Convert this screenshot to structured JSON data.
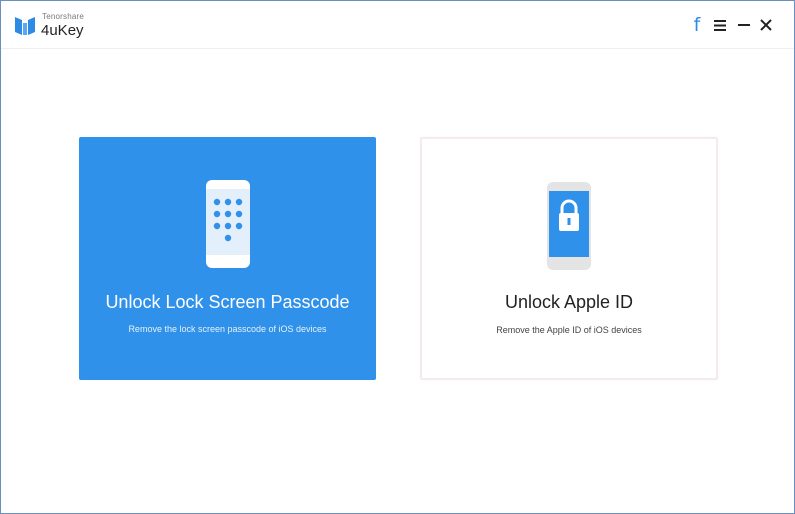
{
  "app": {
    "vendor": "Tenorshare",
    "name": "4uKey"
  },
  "toolbar": {
    "icons": [
      "facebook-icon",
      "menu-icon",
      "minimize-icon",
      "close-icon"
    ],
    "facebook_glyph": "f"
  },
  "options": [
    {
      "title": "Unlock Lock Screen Passcode",
      "description": "Remove the lock screen passcode of iOS devices",
      "icon": "phone-keypad-icon",
      "selected": true
    },
    {
      "title": "Unlock Apple ID",
      "description": "Remove the Apple ID of iOS devices",
      "icon": "phone-lock-icon",
      "selected": false
    }
  ],
  "colors": {
    "accent": "#2f91ea",
    "logo": "#2d8ae5",
    "window_border": "#6b8fbf"
  }
}
